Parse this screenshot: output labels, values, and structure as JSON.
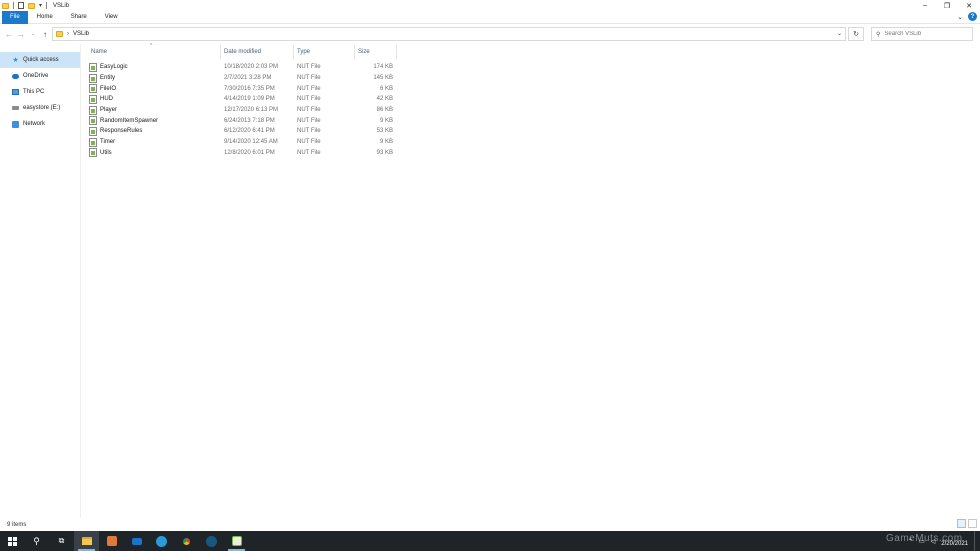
{
  "window": {
    "title": "VSLib",
    "controls": [
      "minimize",
      "restore",
      "close"
    ]
  },
  "ribbon": {
    "tabs": [
      "File",
      "Home",
      "Share",
      "View"
    ]
  },
  "address": {
    "path": [
      "VSLib"
    ],
    "search_placeholder": "Search VSLib"
  },
  "nav": {
    "items": [
      {
        "label": "Quick access",
        "icon": "star-icon",
        "active": true
      },
      {
        "label": "OneDrive",
        "icon": "cloud-icon"
      },
      {
        "label": "This PC",
        "icon": "computer-icon"
      },
      {
        "label": "easystore (E:)",
        "icon": "drive-icon"
      },
      {
        "label": "Network",
        "icon": "network-icon"
      }
    ]
  },
  "columns": {
    "name": "Name",
    "date": "Date modified",
    "type": "Type",
    "size": "Size"
  },
  "files": [
    {
      "name": "EasyLogic",
      "date": "10/18/2020 2:03 PM",
      "type": "NUT File",
      "size": "174 KB"
    },
    {
      "name": "Entity",
      "date": "2/7/2021 3:28 PM",
      "type": "NUT File",
      "size": "145 KB"
    },
    {
      "name": "FileIO",
      "date": "7/30/2016 7:35 PM",
      "type": "NUT File",
      "size": "6 KB"
    },
    {
      "name": "HUD",
      "date": "4/14/2019 1:09 PM",
      "type": "NUT File",
      "size": "42 KB"
    },
    {
      "name": "Player",
      "date": "12/17/2020 6:13 PM",
      "type": "NUT File",
      "size": "86 KB"
    },
    {
      "name": "RandomItemSpawner",
      "date": "6/24/2013 7:18 PM",
      "type": "NUT File",
      "size": "9 KB"
    },
    {
      "name": "ResponseRules",
      "date": "6/12/2020 6:41 PM",
      "type": "NUT File",
      "size": "53 KB"
    },
    {
      "name": "Timer",
      "date": "9/14/2020 12:45 AM",
      "type": "NUT File",
      "size": "9 KB"
    },
    {
      "name": "Utils",
      "date": "12/8/2020 6:01 PM",
      "type": "NUT File",
      "size": "93 KB"
    }
  ],
  "status": {
    "item_count": "9 items"
  },
  "taskbar": {
    "date": "2/20/2021",
    "watermark": "GameMuts.com"
  },
  "colors": {
    "accent": "#1979ca",
    "nav_selected": "#cce4f7",
    "taskbar": "#1f2429"
  }
}
